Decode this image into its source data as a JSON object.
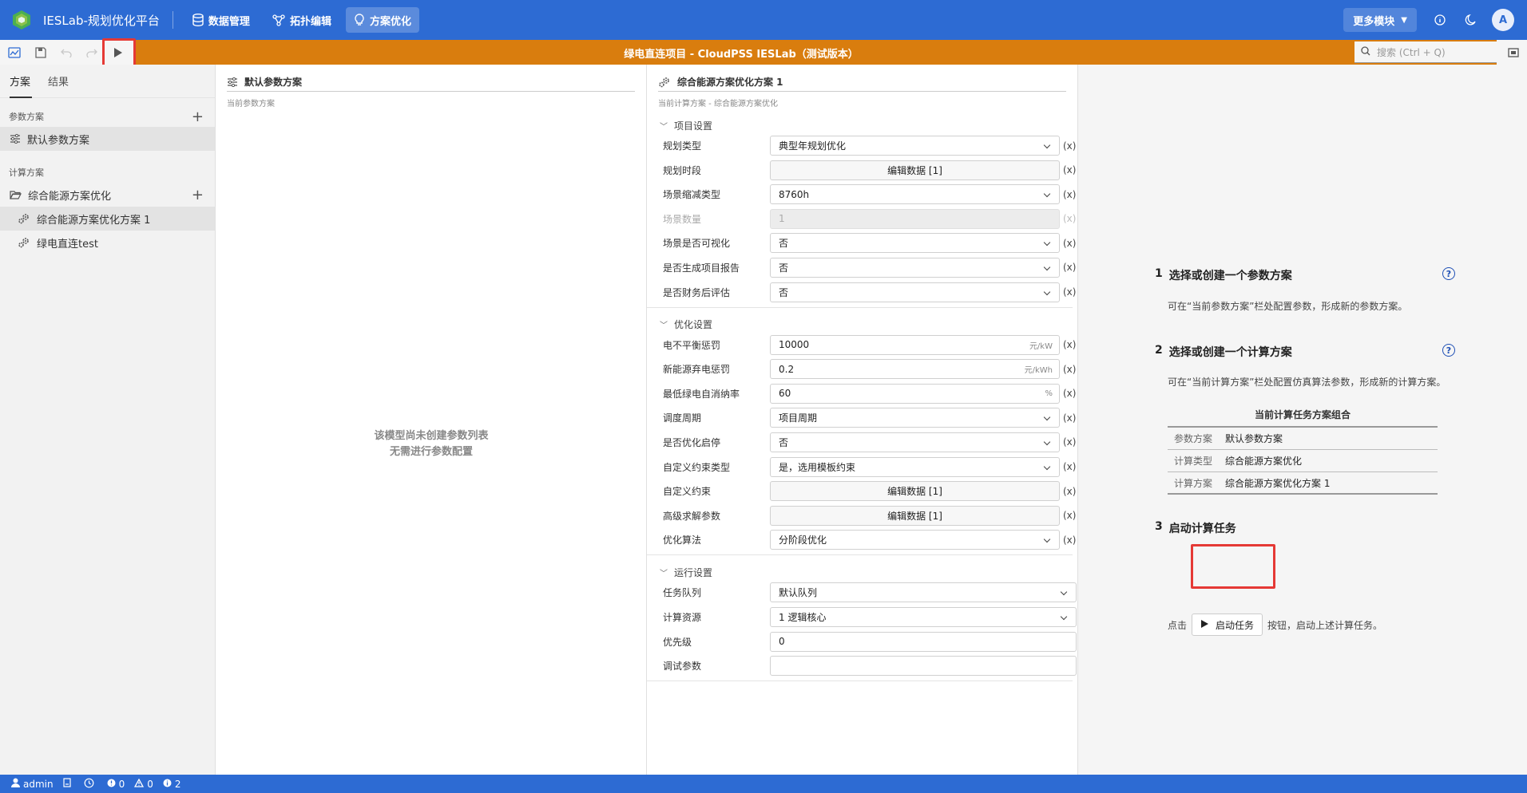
{
  "app": {
    "title": "IESLab-规划优化平台",
    "avatar": "A"
  },
  "nav": {
    "items": [
      {
        "label": "数据管理",
        "icon": "database-icon"
      },
      {
        "label": "拓扑编辑",
        "icon": "topology-icon"
      },
      {
        "label": "方案优化",
        "icon": "bulb-icon",
        "active": true
      }
    ],
    "more": "更多模块"
  },
  "toolbar": {
    "doc_title": "绿电直连项目 - CloudPSS IESLab（测试版本）",
    "search_placeholder": "搜索 (Ctrl + Q)"
  },
  "left": {
    "tabs": [
      "方案",
      "结果"
    ],
    "param_section": "参数方案",
    "param_items": [
      "默认参数方案"
    ],
    "calc_section": "计算方案",
    "calc_folder": "综合能源方案优化",
    "calc_items": [
      "综合能源方案优化方案 1",
      "绿电直连test"
    ]
  },
  "middle": {
    "title": "默认参数方案",
    "subtitle": "当前参数方案",
    "empty_line1": "该模型尚未创建参数列表",
    "empty_line2": "无需进行参数配置"
  },
  "form": {
    "title": "综合能源方案优化方案 1",
    "subtitle": "当前计算方案 - 综合能源方案优化",
    "x_label": "(x)",
    "groups": {
      "project": {
        "title": "项目设置",
        "rows": [
          {
            "label": "规划类型",
            "value": "典型年规划优化"
          },
          {
            "label": "规划时段",
            "value": "编辑数据 [1]"
          },
          {
            "label": "场景缩减类型",
            "value": "8760h"
          },
          {
            "label": "场景数量",
            "value": "1"
          },
          {
            "label": "场景是否可视化",
            "value": "否"
          },
          {
            "label": "是否生成项目报告",
            "value": "否"
          },
          {
            "label": "是否财务后评估",
            "value": "否"
          }
        ]
      },
      "optim": {
        "title": "优化设置",
        "rows": [
          {
            "label": "电不平衡惩罚",
            "value": "10000",
            "unit": "元/kW"
          },
          {
            "label": "新能源弃电惩罚",
            "value": "0.2",
            "unit": "元/kWh"
          },
          {
            "label": "最低绿电自消纳率",
            "value": "60",
            "unit": "%"
          },
          {
            "label": "调度周期",
            "value": "项目周期"
          },
          {
            "label": "是否优化启停",
            "value": "否"
          },
          {
            "label": "自定义约束类型",
            "value": "是，选用模板约束"
          },
          {
            "label": "自定义约束",
            "value": "编辑数据 [1]"
          },
          {
            "label": "高级求解参数",
            "value": "编辑数据 [1]"
          },
          {
            "label": "优化算法",
            "value": "分阶段优化"
          }
        ]
      },
      "run": {
        "title": "运行设置",
        "rows": [
          {
            "label": "任务队列",
            "value": "默认队列"
          },
          {
            "label": "计算资源",
            "value": "1 逻辑核心"
          },
          {
            "label": "优先级",
            "value": "0"
          },
          {
            "label": "调试参数",
            "value": ""
          }
        ]
      }
    }
  },
  "guide": {
    "step1_num": "1",
    "step1_title": "选择或创建一个参数方案",
    "step1_text": "可在“当前参数方案”栏处配置参数，形成新的参数方案。",
    "step2_num": "2",
    "step2_title": "选择或创建一个计算方案",
    "step2_text": "可在“当前计算方案”栏处配置仿真算法参数，形成新的计算方案。",
    "combo_title": "当前计算任务方案组合",
    "combo_rows": [
      {
        "k": "参数方案",
        "v": "默认参数方案"
      },
      {
        "k": "计算类型",
        "v": "综合能源方案优化"
      },
      {
        "k": "计算方案",
        "v": "综合能源方案优化方案 1"
      }
    ],
    "step3_num": "3",
    "step3_title": "启动计算任务",
    "step3_pre": "点击",
    "step3_btn": "启动任务",
    "step3_post": "按钮，启动上述计算任务。"
  },
  "status": {
    "user": "admin",
    "errors": "0",
    "warnings": "0",
    "infos": "2"
  },
  "colors": {
    "primary": "#2d6bd3",
    "toolbar": "#d97d0e",
    "highlight": "#e53935"
  }
}
